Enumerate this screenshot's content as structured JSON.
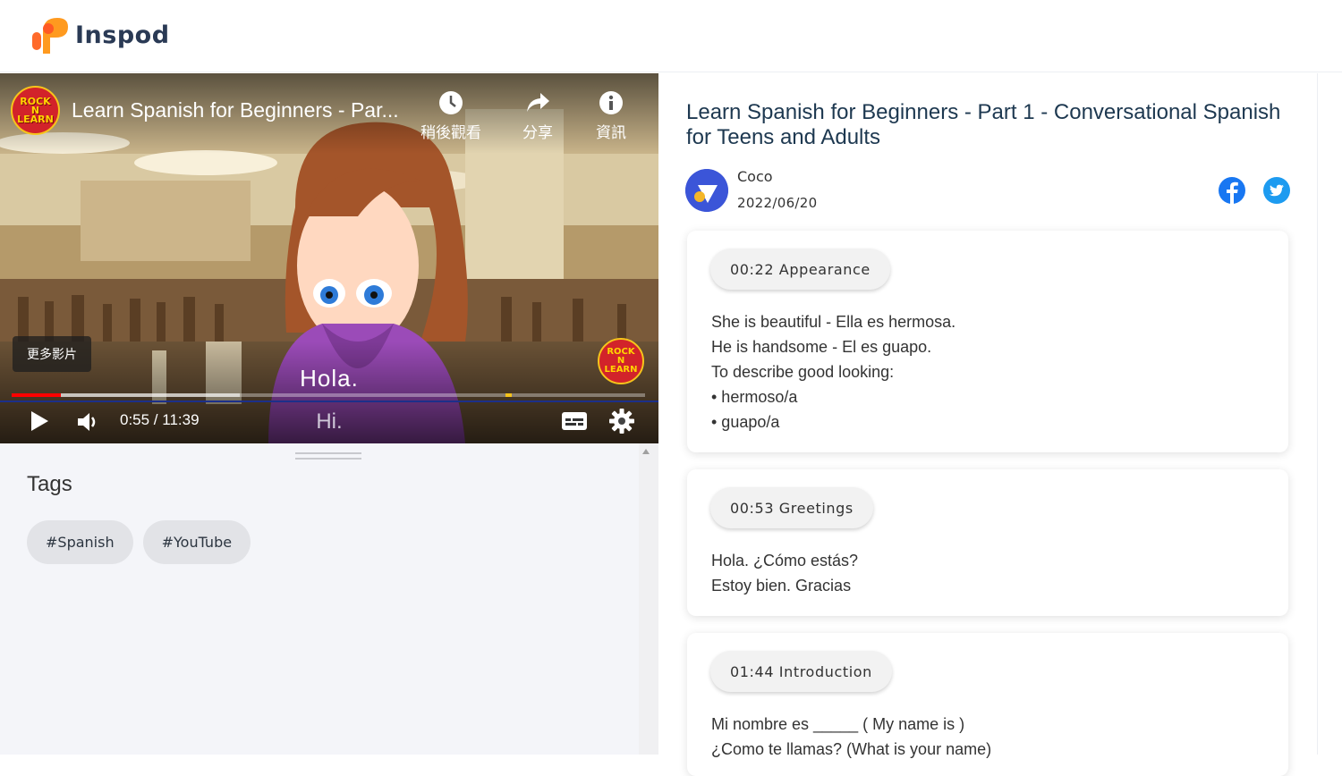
{
  "brand": {
    "name": "Inspod"
  },
  "video": {
    "title": "Learn Spanish for Beginners - Par...",
    "channel_logo_text": [
      "ROCK",
      "N",
      "LEARN"
    ],
    "actions": [
      {
        "label": "稍後觀看",
        "icon": "clock-icon"
      },
      {
        "label": "分享",
        "icon": "share-icon"
      },
      {
        "label": "資訊",
        "icon": "info-icon"
      }
    ],
    "more_videos": "更多影片",
    "subtitle_es": "Hola.",
    "subtitle_en": "Hi.",
    "time": "0:55 / 11:39",
    "progress_played": 0.078,
    "progress_loaded": 0.36,
    "progress_marker": 0.78
  },
  "tags": {
    "title": "Tags",
    "items": [
      "#Spanish",
      "#YouTube"
    ]
  },
  "post": {
    "title": "Learn Spanish for Beginners - Part 1 - Conversational Spanish for Teens and Adults",
    "author": "Coco",
    "date": "2022/06/20"
  },
  "notes": [
    {
      "chip": "00:22 Appearance",
      "lines": [
        "She is beautiful - Ella es hermosa.",
        "He is handsome - El es guapo.",
        "To describe good looking:",
        "• hermoso/a",
        "• guapo/a"
      ]
    },
    {
      "chip": "00:53 Greetings",
      "lines": [
        "Hola. ¿Cómo estás?",
        "Estoy bien. Gracias"
      ]
    },
    {
      "chip": "01:44 Introduction",
      "lines": [
        "Mi nombre es _____ ( My name is )",
        "¿Como te llamas? (What is your name)"
      ]
    }
  ]
}
